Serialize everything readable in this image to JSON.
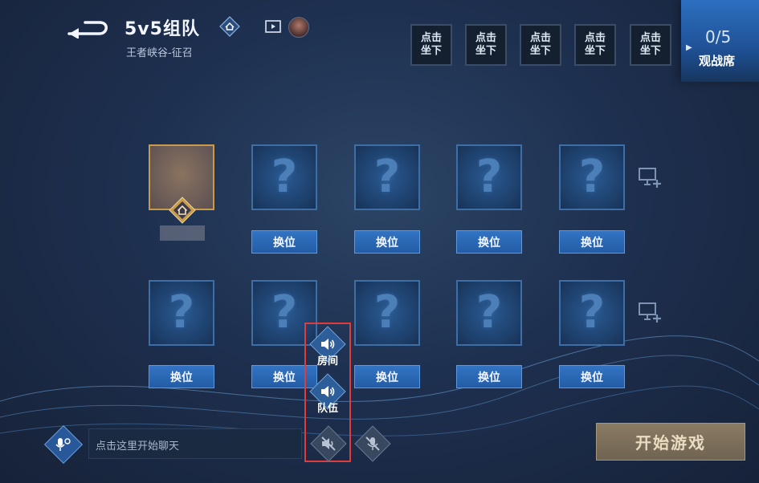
{
  "header": {
    "mode_title": "5v5组队",
    "mode_subtitle": "王者峡谷-征召",
    "back_icon": "back-arrow-icon",
    "home_icon": "home-icon",
    "replay_icon": "video-icon"
  },
  "seats": {
    "labels": [
      "点击\n坐下",
      "点击\n坐下",
      "点击\n坐下",
      "点击\n坐下",
      "点击\n坐下"
    ]
  },
  "spectator": {
    "count": "0/5",
    "label": "观战席"
  },
  "team_slots": {
    "placeholder": "?",
    "swap_label": "换位",
    "host_badge_icon": "home-badge-icon",
    "add_device_icon": "add-pc-icon"
  },
  "voice_menu": {
    "room_label": "房间",
    "team_label": "队伍",
    "mute_icon": "speaker-mute-icon",
    "mic_off_icon": "mic-off-icon",
    "highlight_color": "#e23b3b"
  },
  "chat": {
    "placeholder": "点击这里开始聊天",
    "icon": "voice-chat-icon"
  },
  "start_button": {
    "label": "开始游戏"
  },
  "colors": {
    "accent": "#3274c4",
    "start_button": "#8a7b63",
    "host_border": "#c89a4a"
  }
}
